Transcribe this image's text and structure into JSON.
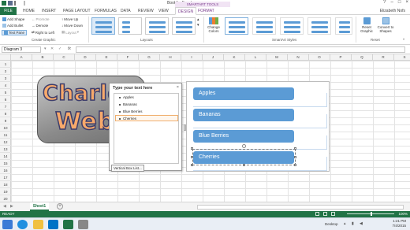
{
  "window": {
    "title": "Book1 - Excel",
    "contextual_tab_group": "SMARTART TOOLS",
    "user": "Elizabeth Nofs"
  },
  "tabs": [
    "FILE",
    "HOME",
    "INSERT",
    "PAGE LAYOUT",
    "FORMULAS",
    "DATA",
    "REVIEW",
    "VIEW",
    "DESIGN",
    "FORMAT"
  ],
  "active_tab": "DESIGN",
  "ribbon": {
    "create_graphic": {
      "label": "Create Graphic",
      "add_shape": "Add Shape",
      "add_bullet": "Add Bullet",
      "text_pane": "Text Pane",
      "promote": "Promote",
      "demote": "Demote",
      "right_to_left": "Right to Left",
      "move_up": "Move Up",
      "move_down": "Move Down",
      "layout": "Layout"
    },
    "layouts": {
      "label": "Layouts"
    },
    "change_colors": "Change Colors",
    "smartart_styles": {
      "label": "SmartArt Styles"
    },
    "reset": {
      "label": "Reset",
      "reset_graphic": "Reset Graphic",
      "convert_to_shapes": "Convert to Shapes"
    }
  },
  "formula_bar": {
    "name_box": "Diagram 3",
    "fx": "fx",
    "value": ""
  },
  "columns": [
    "A",
    "B",
    "C",
    "D",
    "E",
    "F",
    "G",
    "H",
    "I",
    "J",
    "K",
    "L",
    "M",
    "N",
    "O",
    "P",
    "Q",
    "R",
    "S"
  ],
  "rows": [
    "1",
    "2",
    "3",
    "4",
    "5",
    "6",
    "7",
    "8",
    "9",
    "10",
    "11",
    "12",
    "13",
    "14",
    "15",
    "16",
    "17",
    "18",
    "19",
    "20"
  ],
  "wordart": {
    "line1": "Charlot",
    "line2": "Webs"
  },
  "text_pane": {
    "title": "Type your text here",
    "close": "×",
    "items": [
      "Apples",
      "Bananas",
      "Blue Berries",
      "Cherries"
    ],
    "footer": "Vertical Box List..."
  },
  "smartart": {
    "items": [
      "Apples",
      "Bananas",
      "Blue Berries",
      "Cherries"
    ],
    "fill_color": "#5b9bd5"
  },
  "sheets": [
    "Sheet1"
  ],
  "status": {
    "text": "READY",
    "zoom": "100%"
  },
  "taskbar": {
    "desktop": "Desktop",
    "time": "1:21 PM",
    "date": "7/4/2015"
  },
  "colors": {
    "excel_green": "#217346",
    "smartart_purple": "#7a3d8c",
    "accent_blue": "#5b9bd5"
  }
}
